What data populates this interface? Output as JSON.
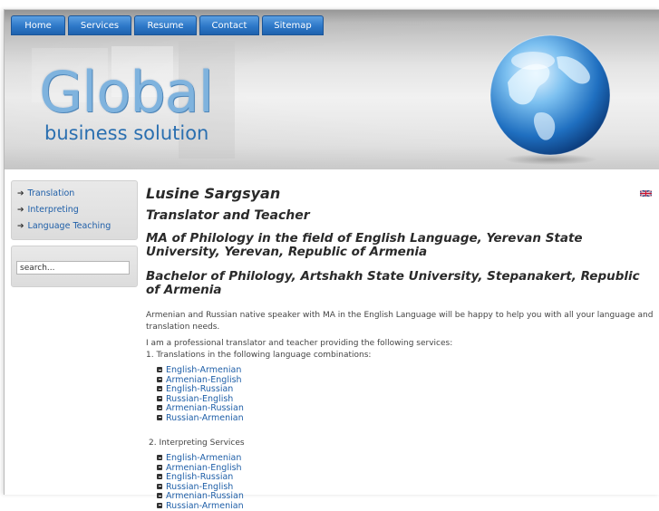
{
  "nav": {
    "items": [
      {
        "label": "Home"
      },
      {
        "label": "Services"
      },
      {
        "label": "Resume"
      },
      {
        "label": "Contact"
      },
      {
        "label": "Sitemap"
      }
    ]
  },
  "header": {
    "logo_main": "Global",
    "logo_sub": "business solution"
  },
  "sidebar": {
    "menu": [
      {
        "label": "Translation"
      },
      {
        "label": "Interpreting"
      },
      {
        "label": "Language Teaching"
      }
    ],
    "search": {
      "value": "search..."
    }
  },
  "content": {
    "name": "Lusine Sargsyan",
    "role": "Translator and Teacher",
    "degree1": "MA of Philology in the field of English Language, Yerevan State University, Yerevan, Republic of Armenia",
    "degree2": "Bachelor of Philology, Artshakh State University, Stepanakert, Republic of Armenia",
    "intro": "Armenian and Russian native speaker with MA in the English Language will be happy to help you with all your language and translation needs.",
    "services_intro": "I am a professional translator and teacher providing the following services:",
    "section1": "1. Translations in the following language combinations:",
    "translations": [
      "English-Armenian",
      "Armenian-English",
      "English-Russian",
      "Russian-English",
      "Armenian-Russian",
      "Russian-Armenian"
    ],
    "section2": "2. Interpreting Services",
    "interpreting": [
      "English-Armenian",
      "Armenian-English",
      "English-Russian",
      "Russian-English",
      "Armenian-Russian",
      "Russian-Armenian"
    ]
  },
  "colors": {
    "nav_blue": "#2d78c8",
    "link_blue": "#1f5fa8",
    "logo_blue": "#7fb3de"
  }
}
